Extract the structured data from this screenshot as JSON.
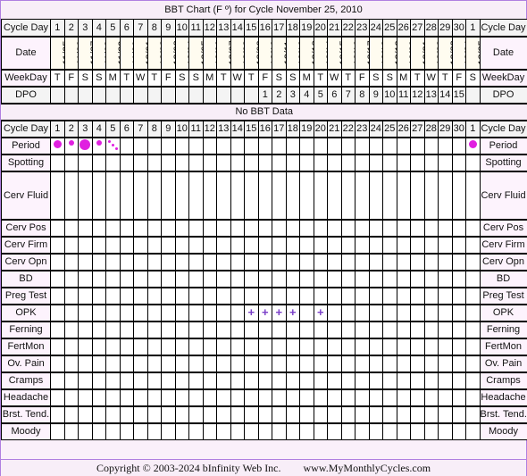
{
  "title": "BBT Chart (F º) for Cycle November 25, 2010",
  "labels": {
    "cycle_day": "Cycle Day",
    "date": "Date",
    "weekday": "WeekDay",
    "dpo": "DPO",
    "no_bbt": "No BBT Data",
    "rows": [
      "Period",
      "Spotting",
      "Cerv Fluid",
      "Cerv Pos",
      "Cerv Firm",
      "Cerv Opn",
      "BD",
      "Preg Test",
      "OPK",
      "Ferning",
      "FertMon",
      "Ov. Pain",
      "Cramps",
      "Headache",
      "Brst. Tend.",
      "Moody"
    ]
  },
  "chart_data": {
    "type": "table",
    "title": "BBT Chart (F º) for Cycle November 25, 2010",
    "cycle_days": [
      "1",
      "2",
      "3",
      "4",
      "5",
      "6",
      "7",
      "8",
      "9",
      "10",
      "11",
      "12",
      "13",
      "14",
      "15",
      "16",
      "17",
      "18",
      "19",
      "20",
      "21",
      "22",
      "23",
      "24",
      "25",
      "26",
      "27",
      "28",
      "29",
      "30",
      "1"
    ],
    "dates": [
      "11/25",
      "11/26",
      "11/27",
      "11/28",
      "11/29",
      "11/30",
      "12/01",
      "12/02",
      "12/03",
      "12/04",
      "12/05",
      "12/06",
      "12/07",
      "12/08",
      "12/09",
      "12/10",
      "12/11",
      "12/12",
      "12/13",
      "12/14",
      "12/15",
      "12/16",
      "12/17",
      "12/18",
      "12/19",
      "12/20",
      "12/21",
      "12/22",
      "12/23",
      "12/24",
      "12/25"
    ],
    "weekdays": [
      "T",
      "F",
      "S",
      "S",
      "M",
      "T",
      "W",
      "T",
      "F",
      "S",
      "S",
      "M",
      "T",
      "W",
      "T",
      "F",
      "S",
      "S",
      "M",
      "T",
      "W",
      "T",
      "F",
      "S",
      "S",
      "M",
      "T",
      "W",
      "T",
      "F",
      "S"
    ],
    "dpo": [
      "",
      "",
      "",
      "",
      "",
      "",
      "",
      "",
      "",
      "",
      "",
      "",
      "",
      "",
      "",
      "1",
      "2",
      "3",
      "4",
      "5",
      "6",
      "7",
      "8",
      "9",
      "10",
      "11",
      "12",
      "13",
      "14",
      "15",
      ""
    ],
    "bbt": "No BBT Data",
    "period": [
      "medium",
      "light",
      "heavy",
      "light",
      "spotting",
      "",
      "",
      "",
      "",
      "",
      "",
      "",
      "",
      "",
      "",
      "",
      "",
      "",
      "",
      "",
      "",
      "",
      "",
      "",
      "",
      "",
      "",
      "",
      "",
      "",
      "medium"
    ],
    "opk": [
      "",
      "",
      "",
      "",
      "",
      "",
      "",
      "",
      "",
      "",
      "",
      "",
      "",
      "",
      "+",
      "+",
      "+",
      "+",
      "",
      "+",
      "",
      "",
      "",
      "",
      "",
      "",
      "",
      "",
      "",
      "",
      ""
    ]
  },
  "footer": {
    "copyright": "Copyright © 2003-2024 bInfinity Web Inc.",
    "site": "www.MyMonthlyCycles.com"
  },
  "colors": {
    "period": "#e020e0",
    "opk": "#7a3fc8",
    "border": "#b07fe0"
  }
}
